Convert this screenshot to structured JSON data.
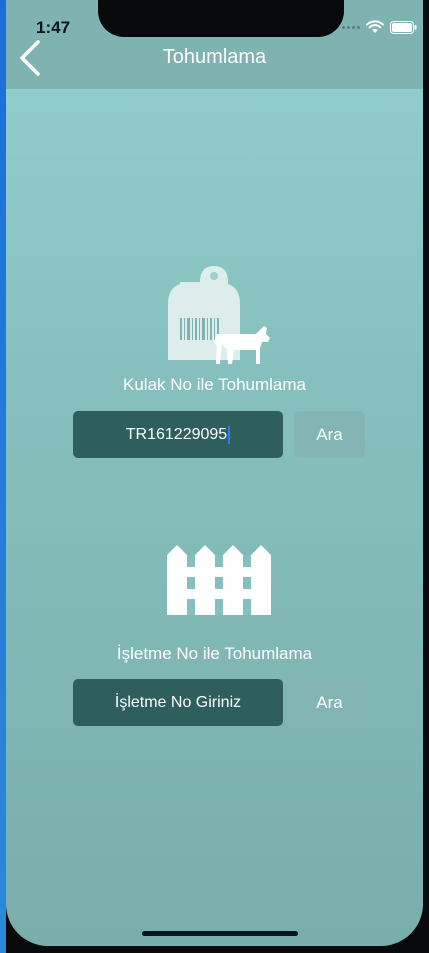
{
  "status_bar": {
    "time": "1:47",
    "icons": [
      "signal-dots-icon",
      "wifi-icon",
      "battery-icon"
    ]
  },
  "navbar": {
    "title": "Tohumlama",
    "back_icon": "chevron-left-icon"
  },
  "ear_section": {
    "icon": "ear-tag-cow-icon",
    "label": "Kulak No ile Tohumlama",
    "input_value": "TR161229095",
    "button_label": "Ara"
  },
  "farm_section": {
    "icon": "fence-icon",
    "label": "İşletme No ile Tohumlama",
    "input_placeholder": "İşletme No Giriniz",
    "button_label": "Ara"
  },
  "colors": {
    "navbar": "#7fb3b1",
    "background_top": "#93d0d1",
    "background_bottom": "#7aaeaa",
    "input_fill": "#2e5f5c",
    "button_fill": "#82b4b2",
    "text": "#ffffff"
  }
}
